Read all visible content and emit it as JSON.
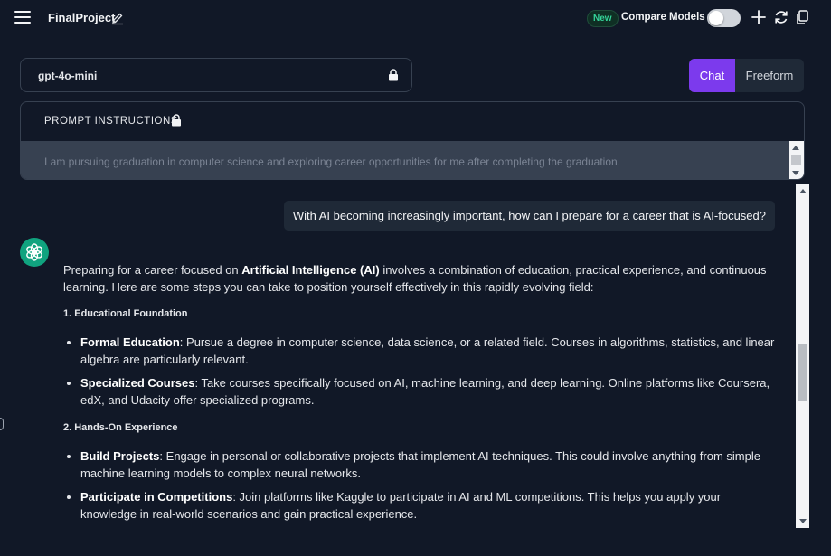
{
  "header": {
    "project_title": "FinalProject",
    "new_badge": "New",
    "compare_models_label": "Compare Models",
    "compare_models_enabled": false
  },
  "model": {
    "name": "gpt-4o-mini"
  },
  "mode": {
    "chat_label": "Chat",
    "freeform_label": "Freeform",
    "active": "Chat"
  },
  "prompt": {
    "header": "PROMPT INSTRUCTIONS",
    "text": "I am pursuing graduation in computer science and exploring career opportunities for me after completing the graduation."
  },
  "colors": {
    "background": "#111827",
    "accent": "#7c3aed",
    "badge_green": "#34d399",
    "assistant_avatar": "#10a37f"
  },
  "conversation": {
    "user_message": "With AI becoming increasingly important, how can I prepare for a career that is AI-focused?",
    "assistant": {
      "intro_pre": "Preparing for a career focused on ",
      "intro_bold": "Artificial Intelligence (AI)",
      "intro_post": " involves a combination of education, practical experience, and continuous learning. Here are some steps you can take to position yourself effectively in this rapidly evolving field:",
      "sections": [
        {
          "title": "1. Educational Foundation",
          "items": [
            {
              "bold": "Formal Education",
              "text": ": Pursue a degree in computer science, data science, or a related field. Courses in algorithms, statistics, and linear algebra are particularly relevant."
            },
            {
              "bold": "Specialized Courses",
              "text": ": Take courses specifically focused on AI, machine learning, and deep learning. Online platforms like Coursera, edX, and Udacity offer specialized programs."
            }
          ]
        },
        {
          "title": "2. Hands-On Experience",
          "items": [
            {
              "bold": "Build Projects",
              "text": ": Engage in personal or collaborative projects that implement AI techniques. This could involve anything from simple machine learning models to complex neural networks."
            },
            {
              "bold": "Participate in Competitions",
              "text": ": Join platforms like Kaggle to participate in AI and ML competitions. This helps you apply your knowledge in real-world scenarios and gain practical experience."
            }
          ]
        }
      ]
    }
  },
  "icons": {
    "menu": "hamburger-menu-icon",
    "edit": "pencil-icon",
    "add": "plus-icon",
    "refresh": "refresh-icon",
    "copy": "copy-icon",
    "lock": "lock-icon",
    "assistant": "openai-logo-icon"
  }
}
